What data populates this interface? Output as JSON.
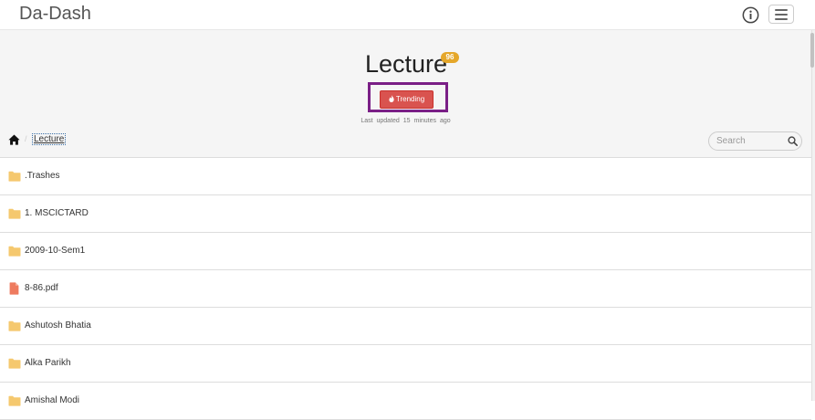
{
  "navbar": {
    "brand": "Da-Dash",
    "info_icon": "info-circle-icon",
    "menu_icon": "hamburger-menu-icon"
  },
  "header": {
    "title": "Lecture",
    "badge_count": "96",
    "trending_label": "Trending",
    "trending_icon": "flame-icon",
    "updated_label": "Last updated",
    "updated_value": "15 minutes",
    "updated_suffix": "ago"
  },
  "breadcrumb": {
    "home_icon": "home-icon",
    "current": "Lecture"
  },
  "search": {
    "placeholder": "Search",
    "value": ""
  },
  "files": [
    {
      "name": ".Trashes",
      "type": "folder"
    },
    {
      "name": "1. MSCICTARD",
      "type": "folder"
    },
    {
      "name": "2009-10-Sem1",
      "type": "folder"
    },
    {
      "name": "8-86.pdf",
      "type": "pdf"
    },
    {
      "name": "Ashutosh Bhatia",
      "type": "folder"
    },
    {
      "name": "Alka Parikh",
      "type": "folder"
    },
    {
      "name": "Amishal Modi",
      "type": "folder"
    }
  ],
  "colors": {
    "accent_red": "#d9534f",
    "badge_orange": "#e5a72a",
    "highlight_purple": "#7a1f86",
    "folder_yellow": "#f5c86e",
    "pdf_orange": "#ee7b5f"
  }
}
